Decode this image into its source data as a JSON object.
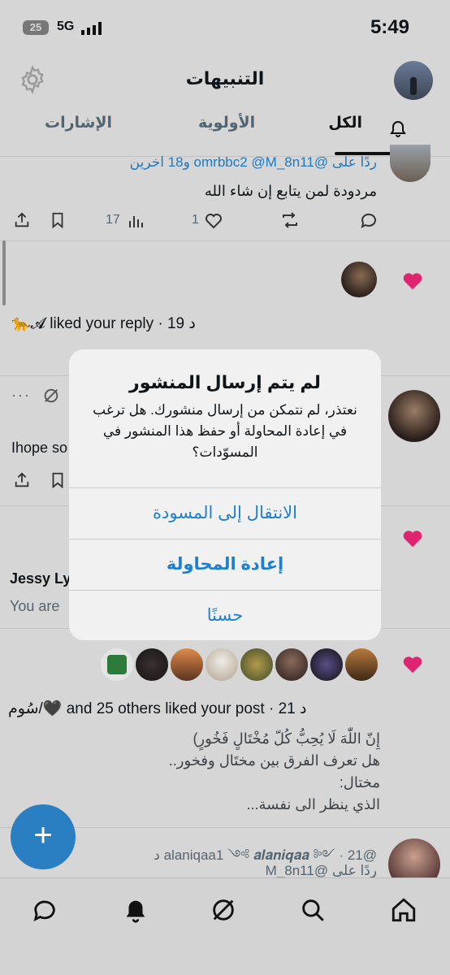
{
  "status_bar": {
    "time": "5:49",
    "battery": "25",
    "network": "5G"
  },
  "header": {
    "title": "التنبيهات",
    "settings_icon": "gear-icon"
  },
  "tabs": [
    {
      "label": "الكل",
      "active": true
    },
    {
      "label": "الأولوية",
      "active": false
    },
    {
      "label": "الإشارات",
      "active": false
    }
  ],
  "notification1": {
    "reply_to": "ردًا على @omrbbc2 @M_8n11 و18 اخرين",
    "text": "مردودة لمن يتابع إن شاء الله",
    "actions": {
      "views": "17",
      "likes": "1"
    }
  },
  "notification2": {
    "text": "🐆𝓐 liked your reply · 19 د"
  },
  "notification3": {
    "text_partial": "Ihope so"
  },
  "notification4": {
    "name_partial": "Jessy Ly",
    "text_partial": "You are"
  },
  "notification5": {
    "text": "سُوم/🖤 and 25 others liked your post · 21 د",
    "post": [
      "إِنّ اللّٰهَ لَا يُحِبُّ كُلّ مُخْتَالٍ فَخُورٍ)",
      "هل تعرف الفرق بين مختَال وفخور..",
      "مختال:",
      "الذي ينظر الى نفسة..."
    ]
  },
  "notification6": {
    "meta": "@alaniqaa1 ༺ 𝒂𝒍𝒂𝒏𝒊𝒒𝒂𝒂 ༻ · 21 د",
    "reply_to": "ردًا على @M_8n11"
  },
  "dialog": {
    "title": "لم يتم إرسال المنشور",
    "message": "نعتذر، لم نتمكن من إرسال منشورك. هل ترغب في إعادة المحاولة أو حفظ هذا المنشور في المسوّدات؟",
    "buttons": [
      "الانتقال إلى المسودة",
      "إعادة المحاولة",
      "حسنًا"
    ]
  },
  "fab": {
    "label": "+"
  },
  "bottom_nav": [
    "home-icon",
    "search-icon",
    "grok-icon",
    "bell-icon",
    "messages-icon"
  ],
  "colors": {
    "accent": "#1d9bf0",
    "heart": "#e0246f",
    "overlay": "#d6d6d6"
  }
}
